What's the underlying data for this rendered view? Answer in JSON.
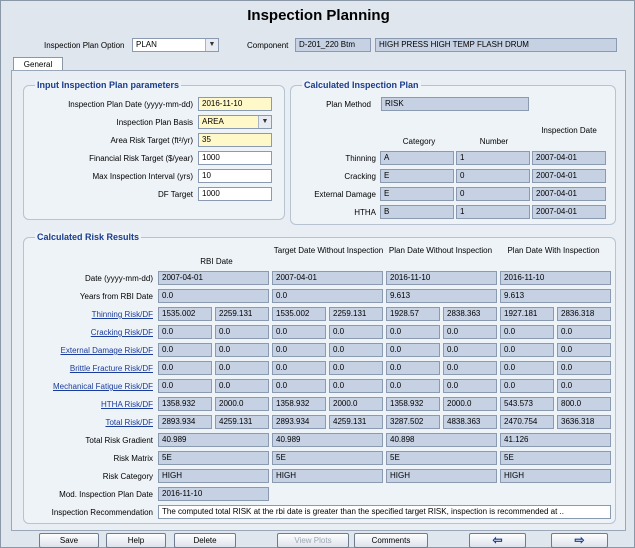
{
  "title": "Inspection Planning",
  "header": {
    "plan_option_label": "Inspection Plan Option",
    "plan_option_value": "PLAN",
    "component_label": "Component",
    "component_id": "D-201_220 Btm",
    "component_desc": "HIGH PRESS HIGH TEMP FLASH DRUM"
  },
  "tab_general": "General",
  "input": {
    "title": "Input Inspection Plan parameters",
    "plan_date_label": "Inspection Plan Date (yyyy-mm-dd)",
    "plan_date": "2016-11-10",
    "basis_label": "Inspection Plan Basis",
    "basis": "AREA",
    "area_risk_label": "Area Risk Target (ft²/yr)",
    "area_risk": "35",
    "fin_risk_label": "Financial Risk Target ($/year)",
    "fin_risk": "1000",
    "max_int_label": "Max Inspection Interval (yrs)",
    "max_int": "10",
    "df_label": "DF Target",
    "df": "1000"
  },
  "calc_plan": {
    "title": "Calculated Inspection Plan",
    "method_label": "Plan Method",
    "method": "RISK",
    "col_category": "Category",
    "col_number": "Number",
    "col_date": "Inspection Date",
    "rows": [
      {
        "label": "Thinning",
        "category": "A",
        "number": "1",
        "date": "2007-04-01"
      },
      {
        "label": "Cracking",
        "category": "E",
        "number": "0",
        "date": "2007-04-01"
      },
      {
        "label": "External Damage",
        "category": "E",
        "number": "0",
        "date": "2007-04-01"
      },
      {
        "label": "HTHA",
        "category": "B",
        "number": "1",
        "date": "2007-04-01"
      }
    ]
  },
  "risk": {
    "title": "Calculated Risk Results",
    "col_headers": [
      "RBI Date",
      "Target Date Without Inspection",
      "Plan Date Without Inspection",
      "Plan Date With Inspection"
    ],
    "date_label": "Date (yyyy-mm-dd)",
    "dates": [
      "2007-04-01",
      "2007-04-01",
      "2016-11-10",
      "2016-11-10"
    ],
    "years_label": "Years from RBI Date",
    "years": [
      "0.0",
      "0.0",
      "9.613",
      "9.613"
    ],
    "pair_rows": [
      {
        "label": "Thinning Risk/DF",
        "values": [
          "1535.002",
          "2259.131",
          "1535.002",
          "2259.131",
          "1928.57",
          "2838.363",
          "1927.181",
          "2836.318"
        ]
      },
      {
        "label": "Cracking Risk/DF",
        "values": [
          "0.0",
          "0.0",
          "0.0",
          "0.0",
          "0.0",
          "0.0",
          "0.0",
          "0.0"
        ]
      },
      {
        "label": "External Damage Risk/DF",
        "values": [
          "0.0",
          "0.0",
          "0.0",
          "0.0",
          "0.0",
          "0.0",
          "0.0",
          "0.0"
        ]
      },
      {
        "label": "Brittle Fracture Risk/DF",
        "values": [
          "0.0",
          "0.0",
          "0.0",
          "0.0",
          "0.0",
          "0.0",
          "0.0",
          "0.0"
        ]
      },
      {
        "label": "Mechanical Fatigue Risk/DF",
        "values": [
          "0.0",
          "0.0",
          "0.0",
          "0.0",
          "0.0",
          "0.0",
          "0.0",
          "0.0"
        ]
      },
      {
        "label": "HTHA Risk/DF",
        "values": [
          "1358.932",
          "2000.0",
          "1358.932",
          "2000.0",
          "1358.932",
          "2000.0",
          "543.573",
          "800.0"
        ]
      },
      {
        "label": "Total Risk/DF",
        "values": [
          "2893.934",
          "4259.131",
          "2893.934",
          "4259.131",
          "3287.502",
          "4838.363",
          "2470.754",
          "3636.318"
        ]
      }
    ],
    "gradient_label": "Total Risk Gradient",
    "gradient": [
      "40.989",
      "40.989",
      "40.898",
      "41.126"
    ],
    "matrix_label": "Risk Matrix",
    "matrix": [
      "5E",
      "5E",
      "5E",
      "5E"
    ],
    "category_label": "Risk Category",
    "category": [
      "HIGH",
      "HIGH",
      "HIGH",
      "HIGH"
    ],
    "mod_date_label": "Mod. Inspection Plan Date",
    "mod_date": "2016-11-10",
    "recommendation_label": "Inspection Recommendation",
    "recommendation": "The computed total RISK at the rbi date is greater than the specified target RISK, inspection is recommended at .."
  },
  "buttons": {
    "save": "Save",
    "help": "Help",
    "delete": "Delete",
    "view_plots": "View Plots",
    "comments": "Comments",
    "back": "⇦",
    "forward": "⇨"
  },
  "colors": {
    "readonly_field": "#c6d2e4",
    "editable_field": "#fff8c8",
    "group_title": "#1a3c8c"
  }
}
